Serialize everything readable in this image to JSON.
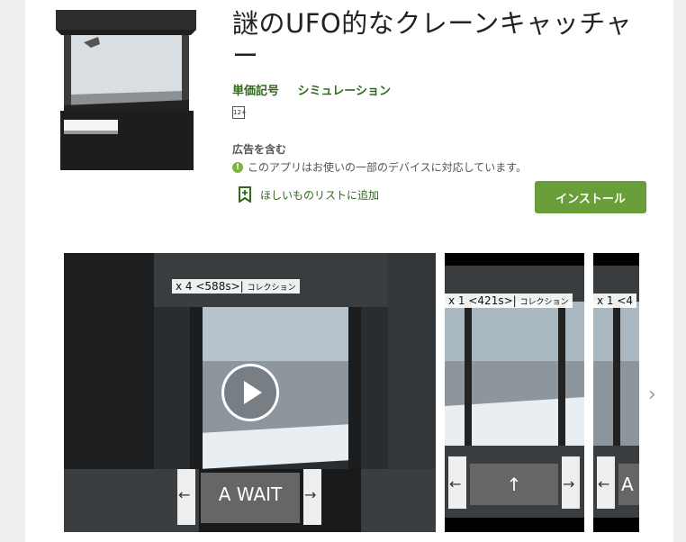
{
  "app": {
    "title": "謎のUFO的なクレーンキャッチャー",
    "developer": "単価記号",
    "category": "シミュレーション",
    "content_rating": "12+",
    "ads_label": "広告を含む",
    "compat_text": "このアプリはお使いの一部のデバイスに対応しています。",
    "wishlist_label": "ほしいものリストに追加",
    "install_label": "インストール"
  },
  "screenshots": [
    {
      "hud": "x 4 <588s>|",
      "hud_suffix": "コレクション",
      "button": "A WAIT",
      "left_arrow": "←",
      "right_arrow": "→"
    },
    {
      "hud": "x 1 <421s>|",
      "hud_suffix": "コレクション",
      "button": "↑",
      "left_arrow": "←",
      "right_arrow": "→"
    },
    {
      "hud": "x 1 <4",
      "hud_suffix": "",
      "button": "A",
      "left_arrow": "←",
      "right_arrow": ""
    }
  ],
  "icons": {
    "info": "info-icon",
    "bookmark": "bookmark-add-icon",
    "play": "play-icon",
    "next": "chevron-right-icon",
    "info_glyph": "!",
    "next_glyph": "›"
  },
  "colors": {
    "accent": "#689f38",
    "developer_text": "#33691e"
  }
}
